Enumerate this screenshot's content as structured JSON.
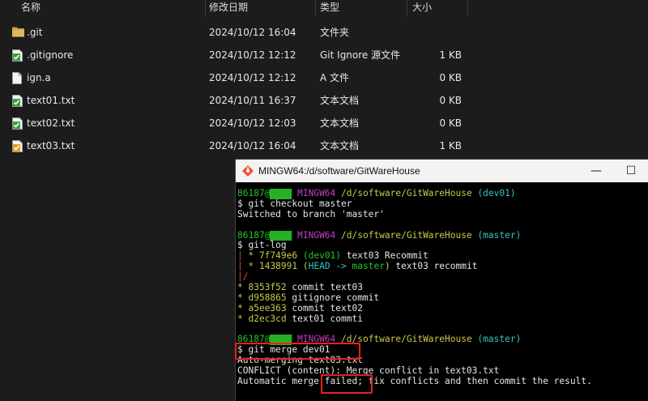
{
  "explorer": {
    "columns": [
      "名称",
      "修改日期",
      "类型",
      "大小"
    ],
    "files": [
      {
        "name": ".git",
        "date": "2024/10/12 16:04",
        "type": "文件夹",
        "size": "",
        "icon": "folder-icon"
      },
      {
        "name": ".gitignore",
        "date": "2024/10/12 12:12",
        "type": "Git Ignore 源文件",
        "size": "1 KB",
        "icon": "git-file-icon"
      },
      {
        "name": "ign.a",
        "date": "2024/10/12 12:12",
        "type": "A 文件",
        "size": "0 KB",
        "icon": "file-icon"
      },
      {
        "name": "text01.txt",
        "date": "2024/10/11 16:37",
        "type": "文本文档",
        "size": "0 KB",
        "icon": "git-file-icon"
      },
      {
        "name": "text02.txt",
        "date": "2024/10/12 12:03",
        "type": "文本文档",
        "size": "0 KB",
        "icon": "git-file-icon"
      },
      {
        "name": "text03.txt",
        "date": "2024/10/12 16:04",
        "type": "文本文档",
        "size": "1 KB",
        "icon": "git-conflict-file-icon"
      }
    ]
  },
  "terminal": {
    "title": "MINGW64:/d/software/GitWareHouse",
    "window_buttons": {
      "minimize": "—",
      "maximize": "☐"
    },
    "prompt_user": "86187@",
    "prompt_host_masked": "▒▒▒▒",
    "prompt_env": "MINGW64",
    "prompt_path": "/d/software/GitWareHouse",
    "prompt_prefix": "$ ",
    "blocks": [
      {
        "branch": "(dev01)",
        "command": "git checkout master",
        "output": [
          "Switched to branch 'master'"
        ]
      },
      {
        "branch": "(master)",
        "command": "git-log",
        "log": [
          {
            "graph": "| * ",
            "hash": "7f749e6",
            "refs": "(dev01)",
            "msg": " text03 Recommit"
          },
          {
            "graph": "| * ",
            "hash": "1438991",
            "refs": "(HEAD -> master)",
            "msg": " text03 recommit"
          },
          {
            "graph": "|/",
            "hash": "",
            "refs": "",
            "msg": ""
          },
          {
            "graph": "* ",
            "hash": "8353f52",
            "refs": "",
            "msg": " commit text03"
          },
          {
            "graph": "* ",
            "hash": "d958865",
            "refs": "",
            "msg": " gitignore commit"
          },
          {
            "graph": "* ",
            "hash": "a5ee363",
            "refs": "",
            "msg": " commit text02"
          },
          {
            "graph": "* ",
            "hash": "d2ec3cd",
            "refs": "",
            "msg": " text01 commti"
          }
        ]
      },
      {
        "branch": "(master)",
        "command": "git merge dev01",
        "output": [
          "Auto-merging text03.txt",
          "CONFLICT (content): Merge conflict in text03.txt"
        ],
        "final_line": {
          "before": "Automatic merge ",
          "highlight": "failed;",
          "after": " fix conflicts and then commit the result."
        }
      }
    ]
  },
  "colors": {
    "highlight_box": "#e8221f",
    "prompt_user": "#26c326",
    "prompt_env": "#c040c0",
    "prompt_path": "#c8c84a",
    "branch": "#33c3c3"
  }
}
